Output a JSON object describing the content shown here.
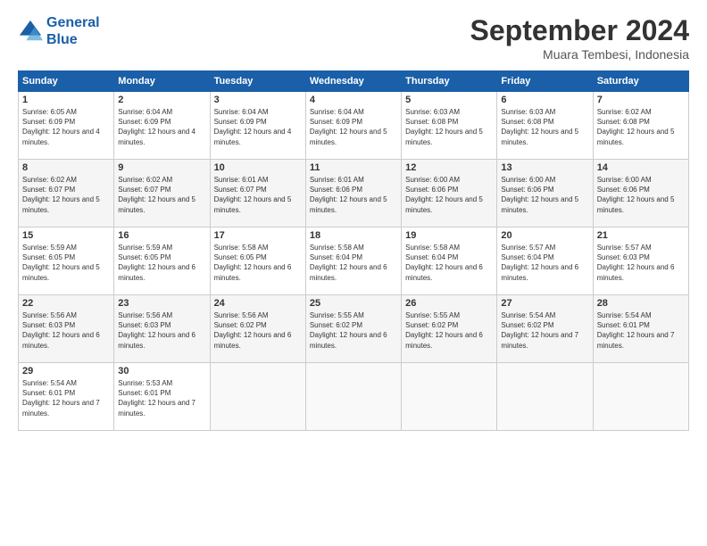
{
  "logo": {
    "line1": "General",
    "line2": "Blue"
  },
  "title": "September 2024",
  "location": "Muara Tembesi, Indonesia",
  "days_header": [
    "Sunday",
    "Monday",
    "Tuesday",
    "Wednesday",
    "Thursday",
    "Friday",
    "Saturday"
  ],
  "weeks": [
    [
      {
        "day": "1",
        "rise": "6:05 AM",
        "set": "6:09 PM",
        "daylight": "12 hours and 4 minutes."
      },
      {
        "day": "2",
        "rise": "6:04 AM",
        "set": "6:09 PM",
        "daylight": "12 hours and 4 minutes."
      },
      {
        "day": "3",
        "rise": "6:04 AM",
        "set": "6:09 PM",
        "daylight": "12 hours and 4 minutes."
      },
      {
        "day": "4",
        "rise": "6:04 AM",
        "set": "6:09 PM",
        "daylight": "12 hours and 5 minutes."
      },
      {
        "day": "5",
        "rise": "6:03 AM",
        "set": "6:08 PM",
        "daylight": "12 hours and 5 minutes."
      },
      {
        "day": "6",
        "rise": "6:03 AM",
        "set": "6:08 PM",
        "daylight": "12 hours and 5 minutes."
      },
      {
        "day": "7",
        "rise": "6:02 AM",
        "set": "6:08 PM",
        "daylight": "12 hours and 5 minutes."
      }
    ],
    [
      {
        "day": "8",
        "rise": "6:02 AM",
        "set": "6:07 PM",
        "daylight": "12 hours and 5 minutes."
      },
      {
        "day": "9",
        "rise": "6:02 AM",
        "set": "6:07 PM",
        "daylight": "12 hours and 5 minutes."
      },
      {
        "day": "10",
        "rise": "6:01 AM",
        "set": "6:07 PM",
        "daylight": "12 hours and 5 minutes."
      },
      {
        "day": "11",
        "rise": "6:01 AM",
        "set": "6:06 PM",
        "daylight": "12 hours and 5 minutes."
      },
      {
        "day": "12",
        "rise": "6:00 AM",
        "set": "6:06 PM",
        "daylight": "12 hours and 5 minutes."
      },
      {
        "day": "13",
        "rise": "6:00 AM",
        "set": "6:06 PM",
        "daylight": "12 hours and 5 minutes."
      },
      {
        "day": "14",
        "rise": "6:00 AM",
        "set": "6:06 PM",
        "daylight": "12 hours and 5 minutes."
      }
    ],
    [
      {
        "day": "15",
        "rise": "5:59 AM",
        "set": "6:05 PM",
        "daylight": "12 hours and 5 minutes."
      },
      {
        "day": "16",
        "rise": "5:59 AM",
        "set": "6:05 PM",
        "daylight": "12 hours and 6 minutes."
      },
      {
        "day": "17",
        "rise": "5:58 AM",
        "set": "6:05 PM",
        "daylight": "12 hours and 6 minutes."
      },
      {
        "day": "18",
        "rise": "5:58 AM",
        "set": "6:04 PM",
        "daylight": "12 hours and 6 minutes."
      },
      {
        "day": "19",
        "rise": "5:58 AM",
        "set": "6:04 PM",
        "daylight": "12 hours and 6 minutes."
      },
      {
        "day": "20",
        "rise": "5:57 AM",
        "set": "6:04 PM",
        "daylight": "12 hours and 6 minutes."
      },
      {
        "day": "21",
        "rise": "5:57 AM",
        "set": "6:03 PM",
        "daylight": "12 hours and 6 minutes."
      }
    ],
    [
      {
        "day": "22",
        "rise": "5:56 AM",
        "set": "6:03 PM",
        "daylight": "12 hours and 6 minutes."
      },
      {
        "day": "23",
        "rise": "5:56 AM",
        "set": "6:03 PM",
        "daylight": "12 hours and 6 minutes."
      },
      {
        "day": "24",
        "rise": "5:56 AM",
        "set": "6:02 PM",
        "daylight": "12 hours and 6 minutes."
      },
      {
        "day": "25",
        "rise": "5:55 AM",
        "set": "6:02 PM",
        "daylight": "12 hours and 6 minutes."
      },
      {
        "day": "26",
        "rise": "5:55 AM",
        "set": "6:02 PM",
        "daylight": "12 hours and 6 minutes."
      },
      {
        "day": "27",
        "rise": "5:54 AM",
        "set": "6:02 PM",
        "daylight": "12 hours and 7 minutes."
      },
      {
        "day": "28",
        "rise": "5:54 AM",
        "set": "6:01 PM",
        "daylight": "12 hours and 7 minutes."
      }
    ],
    [
      {
        "day": "29",
        "rise": "5:54 AM",
        "set": "6:01 PM",
        "daylight": "12 hours and 7 minutes."
      },
      {
        "day": "30",
        "rise": "5:53 AM",
        "set": "6:01 PM",
        "daylight": "12 hours and 7 minutes."
      },
      null,
      null,
      null,
      null,
      null
    ]
  ]
}
